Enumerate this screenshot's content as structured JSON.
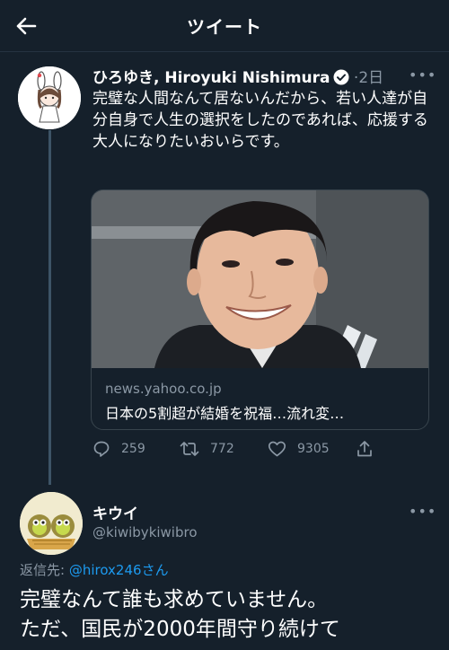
{
  "header": {
    "title": "ツイート",
    "back_icon": "arrow-left-icon"
  },
  "tweet": {
    "author_name": "ひろゆき, Hiroyuki Nishimura",
    "verified_icon": "verified-badge-icon",
    "separator": "·",
    "time": "2日",
    "more_label": "•••",
    "text": "完璧な人間なんて居ないんだから、若い人達が自分自身で人生の選択をしたのであれば、応援する大人になりたいおいらです。",
    "card": {
      "domain": "news.yahoo.co.jp",
      "title": "日本の5割超が結婚を祝福…流れ変…"
    },
    "actions": {
      "replies": "259",
      "retweets": "772",
      "likes": "9305"
    }
  },
  "reply": {
    "author_name": "キウイ",
    "handle": "@kiwibykiwibro",
    "more_label": "•••",
    "reply_prefix": "返信先: ",
    "reply_mention": "@hirox246さん",
    "text_line1": "完璧なんて誰も求めていません。",
    "text_line2": "ただ、国民が2000年間守り続けて"
  },
  "colors": {
    "background": "#15202b",
    "secondary_text": "#8b98a5",
    "accent": "#1d9bf0",
    "border": "#38444d"
  }
}
